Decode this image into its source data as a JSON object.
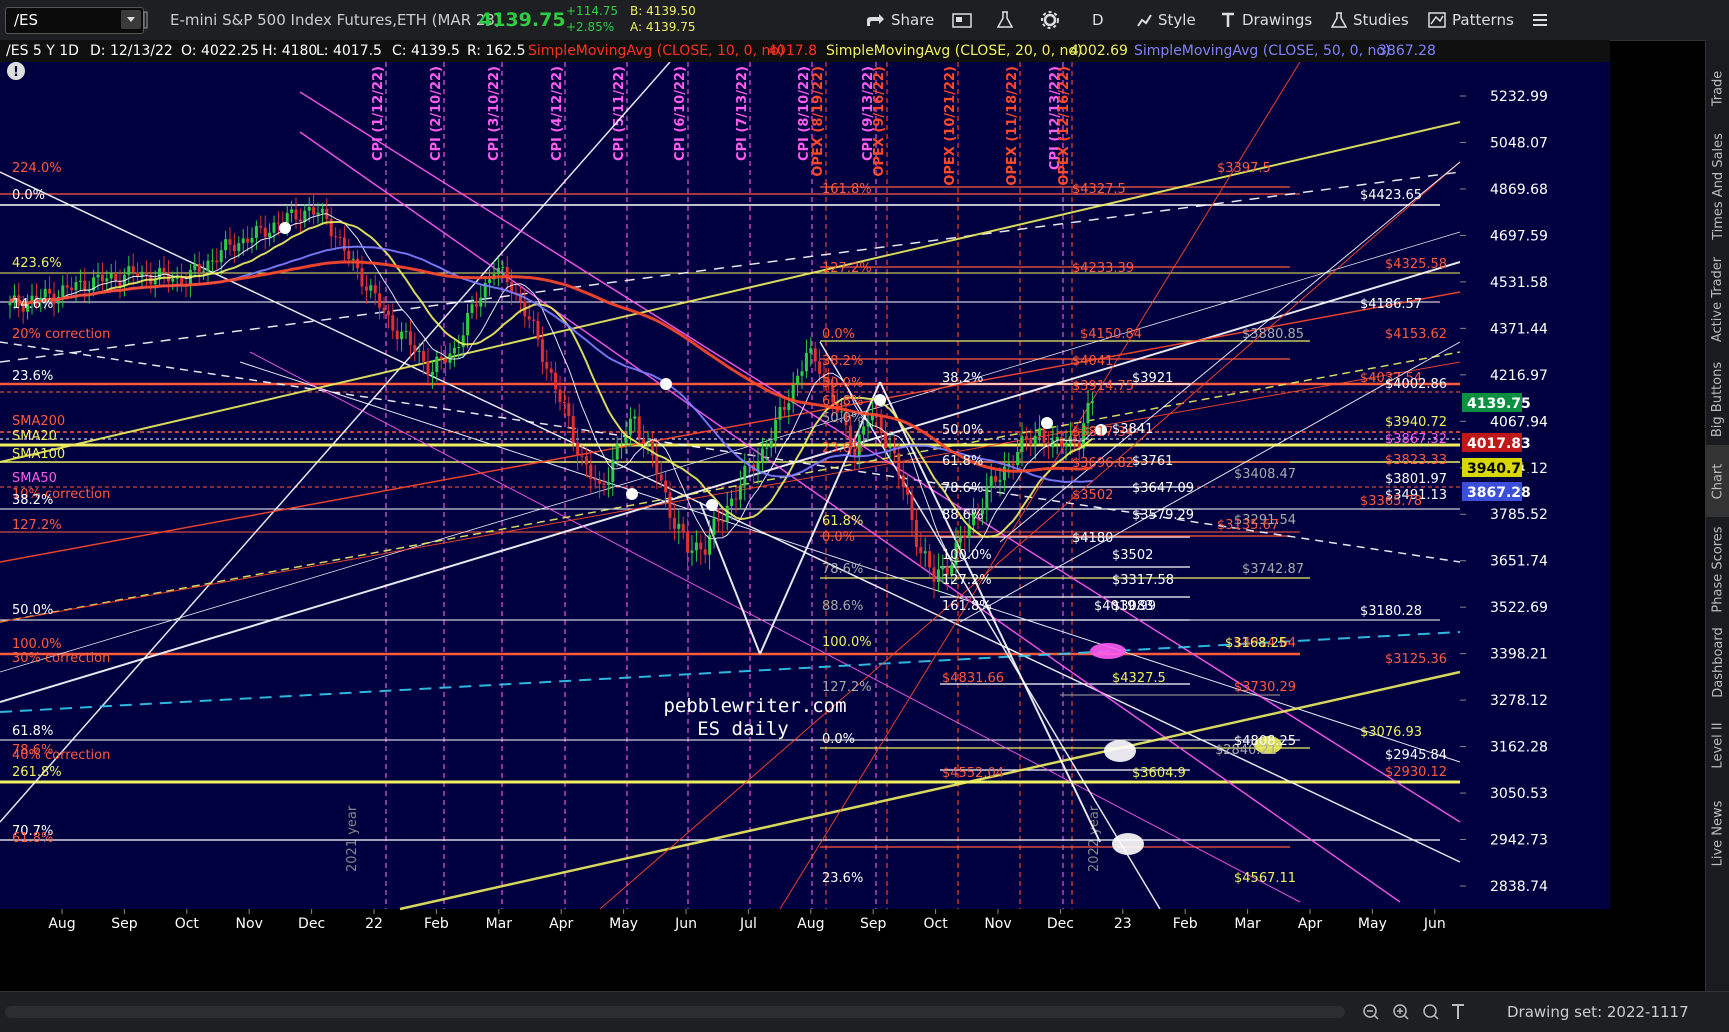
{
  "toolbar": {
    "symbol": "/ES",
    "instrument": "E-mini S&P 500 Index Futures,ETH (MAR 23)",
    "last": "4139.75",
    "change": "+114.75",
    "change_pct": "+2.85%",
    "bid": "B: 4139.50",
    "ask": "A: 4139.75",
    "share": "Share",
    "timeframe": "D",
    "style": "Style",
    "drawings": "Drawings",
    "studies": "Studies",
    "patterns": "Patterns"
  },
  "infoline": {
    "symbol_tf": "/ES 5 Y 1D",
    "date": "D: 12/13/22",
    "open": "O: 4022.25",
    "high": "H: 4180",
    "low": "L: 4017.5",
    "close": "C: 4139.5",
    "range": "R: 162.5",
    "sma10_label": "SimpleMovingAvg (CLOSE, 10, 0, no)",
    "sma10_value": "4017.8",
    "sma20_label": "SimpleMovingAvg (CLOSE, 20, 0, no)",
    "sma20_value": "4002.69",
    "sma50_label": "SimpleMovingAvg (CLOSE, 50, 0, no)",
    "sma50_value": "3867.28"
  },
  "colors": {
    "background": "#000040",
    "up": "#2ecc40",
    "down": "#e03030",
    "sma10": "#ff4020",
    "sma20": "#f0f060",
    "sma50": "#8080ff",
    "fib_red": "#ff5a3c",
    "fib_yellow": "#f0f060",
    "magenta": "#ff5cf0"
  },
  "chart_data": {
    "type": "candlestick",
    "y_ticks": [
      5232.99,
      5048.07,
      4869.68,
      4697.59,
      4531.58,
      4371.44,
      4216.97,
      4067.94,
      3924.12,
      3785.52,
      3651.74,
      3522.69,
      3398.21,
      3278.12,
      3162.28,
      3050.53,
      2942.73,
      2838.74
    ],
    "x_ticks": [
      "Aug",
      "Sep",
      "Oct",
      "Nov",
      "Dec",
      "22",
      "Feb",
      "Mar",
      "Apr",
      "May",
      "Jun",
      "Jul",
      "Aug",
      "Sep",
      "Oct",
      "Nov",
      "Dec",
      "23",
      "Feb",
      "Mar",
      "Apr",
      "May",
      "Jun"
    ],
    "price_badges": [
      {
        "value": "4139.75",
        "color": "#0a9040"
      },
      {
        "value": "4017.83",
        "color": "#c01818"
      },
      {
        "value": "3940.73",
        "color": "#d8d800"
      },
      {
        "value": "3867.28",
        "color": "#3b4fd8"
      }
    ],
    "series": [
      {
        "name": "SimpleMovingAvg (CLOSE, 10, 0, no)",
        "last": 4017.8
      },
      {
        "name": "SimpleMovingAvg (CLOSE, 20, 0, no)",
        "last": 4002.69
      },
      {
        "name": "SimpleMovingAvg (CLOSE, 50, 0, no)",
        "last": 3867.28
      }
    ],
    "close_path": [
      [
        0,
        4450
      ],
      [
        8,
        4480
      ],
      [
        18,
        4530
      ],
      [
        28,
        4560
      ],
      [
        40,
        4540
      ],
      [
        50,
        4660
      ],
      [
        56,
        4700
      ],
      [
        63,
        4760
      ],
      [
        68,
        4790
      ],
      [
        72,
        4760
      ],
      [
        76,
        4640
      ],
      [
        82,
        4500
      ],
      [
        86,
        4400
      ],
      [
        92,
        4300
      ],
      [
        96,
        4230
      ],
      [
        101,
        4300
      ],
      [
        106,
        4460
      ],
      [
        110,
        4580
      ],
      [
        114,
        4520
      ],
      [
        118,
        4400
      ],
      [
        122,
        4250
      ],
      [
        126,
        4100
      ],
      [
        130,
        3950
      ],
      [
        134,
        3850
      ],
      [
        137,
        3950
      ],
      [
        142,
        4080
      ],
      [
        146,
        3950
      ],
      [
        150,
        3800
      ],
      [
        154,
        3680
      ],
      [
        158,
        3700
      ],
      [
        162,
        3780
      ],
      [
        166,
        3880
      ],
      [
        170,
        3950
      ],
      [
        174,
        4050
      ],
      [
        178,
        4180
      ],
      [
        181,
        4280
      ],
      [
        184,
        4250
      ],
      [
        188,
        4100
      ],
      [
        192,
        3980
      ],
      [
        195,
        4080
      ],
      [
        198,
        4050
      ],
      [
        201,
        3950
      ],
      [
        204,
        3820
      ],
      [
        207,
        3680
      ],
      [
        210,
        3600
      ],
      [
        213,
        3640
      ],
      [
        216,
        3700
      ],
      [
        219,
        3780
      ],
      [
        222,
        3850
      ],
      [
        225,
        3900
      ],
      [
        228,
        3960
      ],
      [
        231,
        4000
      ],
      [
        234,
        4040
      ],
      [
        237,
        3980
      ],
      [
        240,
        4020
      ],
      [
        243,
        4000
      ],
      [
        246,
        4139
      ]
    ],
    "period_labels": [
      {
        "text": "CPI (1/12/22)",
        "color": "#ff5cf0"
      },
      {
        "text": "CPI (2/10/22)",
        "color": "#ff5cf0"
      },
      {
        "text": "CPI (3/10/22)",
        "color": "#ff5cf0"
      },
      {
        "text": "CPI (4/12/22)",
        "color": "#ff5cf0"
      },
      {
        "text": "CPI (5/11/22)",
        "color": "#ff5cf0"
      },
      {
        "text": "CPI (6/10/22)",
        "color": "#ff5cf0"
      },
      {
        "text": "CPI (7/13/22)",
        "color": "#ff5cf0"
      },
      {
        "text": "CPI (8/10/22)",
        "color": "#ff5cf0"
      },
      {
        "text": "OPEX (8/19/22)",
        "color": "#ff4a2a"
      },
      {
        "text": "CPI (9/13/22)",
        "color": "#ff5cf0"
      },
      {
        "text": "OPEX (9/16/22)",
        "color": "#ff4a2a"
      },
      {
        "text": "OPEX (10/21/22)",
        "color": "#ff4a2a"
      },
      {
        "text": "OPEX (11/18/22)",
        "color": "#ff4a2a"
      },
      {
        "text": "CPI (12/13/22)",
        "color": "#ff5cf0"
      },
      {
        "text": "OPEX (12/16/22)",
        "color": "#ff4a2a"
      }
    ],
    "year_labels": [
      "2021 year",
      "2022 year"
    ],
    "level_labels": [
      {
        "text": "224.0%",
        "color": "#ff5a3c"
      },
      {
        "text": "0.0%",
        "color": "#ffffff"
      },
      {
        "text": "423.6%",
        "color": "#f0f060"
      },
      {
        "text": "14.6%",
        "color": "#ffffff"
      },
      {
        "text": "20% correction",
        "color": "#ff5a3c"
      },
      {
        "text": "23.6%",
        "color": "#ffffff"
      },
      {
        "text": "SMA200",
        "color": "#ff5a3c"
      },
      {
        "text": "SMA20",
        "color": "#f0f060"
      },
      {
        "text": "SMA100",
        "color": "#f0f060"
      },
      {
        "text": "SMA50",
        "color": "#ff5cf0"
      },
      {
        "text": "10% correction",
        "color": "#ff5a3c"
      },
      {
        "text": "38.2%",
        "color": "#ffffff"
      },
      {
        "text": "127.2%",
        "color": "#ff5a3c"
      },
      {
        "text": "50.0%",
        "color": "#ffffff"
      },
      {
        "text": "100.0%",
        "color": "#ff5a3c"
      },
      {
        "text": "30% correction",
        "color": "#ff5a3c"
      },
      {
        "text": "61.8%",
        "color": "#ffffff"
      },
      {
        "text": "78.6%",
        "color": "#ff5a3c"
      },
      {
        "text": "40% correction",
        "color": "#ff5a3c"
      },
      {
        "text": "261.8%",
        "color": "#f0f060"
      },
      {
        "text": "70.7%",
        "color": "#ffffff"
      },
      {
        "text": "61.8%",
        "color": "#ff5a3c"
      },
      {
        "text": "161.8%",
        "color": "#ff5a3c"
      },
      {
        "text": "127.2%",
        "color": "#ff5a3c"
      },
      {
        "text": "0.0%",
        "color": "#ff5a3c"
      },
      {
        "text": "38.2%",
        "color": "#ff5a3c"
      },
      {
        "text": "50.0%",
        "color": "#ff5a3c"
      },
      {
        "text": "61.8%",
        "color": "#ff5a3c"
      },
      {
        "text": "50.0%",
        "color": "#aaaaaa"
      },
      {
        "text": "23.6%",
        "color": "#ff5a3c"
      },
      {
        "text": "61.8%",
        "color": "#f0f060"
      },
      {
        "text": "0.0%",
        "color": "#ff5a3c"
      },
      {
        "text": "78.6%",
        "color": "#aaaaaa"
      },
      {
        "text": "88.6%",
        "color": "#aaaaaa"
      },
      {
        "text": "100.0%",
        "color": "#f0f060"
      },
      {
        "text": "127.2%",
        "color": "#aaaaaa"
      },
      {
        "text": "0.0%",
        "color": "#ffffff"
      },
      {
        "text": "23.6%",
        "color": "#ffffff"
      },
      {
        "text": "38.2%",
        "color": "#ffffff"
      },
      {
        "text": "50.0%",
        "color": "#ffffff"
      },
      {
        "text": "61.8%",
        "color": "#ffffff"
      },
      {
        "text": "78.6%",
        "color": "#ffffff"
      },
      {
        "text": "88.6%",
        "color": "#ffffff"
      },
      {
        "text": "100.0%",
        "color": "#ffffff"
      },
      {
        "text": "127.2%",
        "color": "#ffffff"
      },
      {
        "text": "161.8%",
        "color": "#ffffff"
      },
      {
        "text": "$4831.66",
        "color": "#ff5a3c"
      },
      {
        "text": "$4552.04",
        "color": "#ff5a3c"
      },
      {
        "text": "$4327.5",
        "color": "#ff5a3c"
      },
      {
        "text": "$4233.39",
        "color": "#ff5a3c"
      },
      {
        "text": "$4150.84",
        "color": "#ff5a3c"
      },
      {
        "text": "$4041",
        "color": "#ff5a3c"
      },
      {
        "text": "$3914.75",
        "color": "#ff5a3c"
      },
      {
        "text": "$3817.34",
        "color": "#ff5a3c"
      },
      {
        "text": "$3696.82",
        "color": "#ff5a3c"
      },
      {
        "text": "$3502",
        "color": "#ff5a3c"
      },
      {
        "text": "$4180",
        "color": "#ffffff"
      },
      {
        "text": "$4019.99",
        "color": "#ffffff"
      },
      {
        "text": "$3921",
        "color": "#ffffff"
      },
      {
        "text": "$3841",
        "color": "#ffffff"
      },
      {
        "text": "$3761",
        "color": "#ffffff"
      },
      {
        "text": "$3647.09",
        "color": "#ffffff"
      },
      {
        "text": "$3579.29",
        "color": "#ffffff"
      },
      {
        "text": "$3502",
        "color": "#ffffff"
      },
      {
        "text": "$3317.58",
        "color": "#ffffff"
      },
      {
        "text": "$3083",
        "color": "#ffffff"
      },
      {
        "text": "$4327.5",
        "color": "#f0f060"
      },
      {
        "text": "$3604.9",
        "color": "#f0f060"
      },
      {
        "text": "$3880.85",
        "color": "#aaaaaa"
      },
      {
        "text": "$3742.87",
        "color": "#aaaaaa"
      },
      {
        "text": "$3408.47",
        "color": "#aaaaaa"
      },
      {
        "text": "$3291.54",
        "color": "#aaaaaa"
      },
      {
        "text": "$4914.64",
        "color": "#ff5a3c"
      },
      {
        "text": "$3730.29",
        "color": "#ff5a3c"
      },
      {
        "text": "$3397.5",
        "color": "#ff5a3c"
      },
      {
        "text": "$3135.67",
        "color": "#ff5a3c"
      },
      {
        "text": "$3168.25",
        "color": "#f0f060"
      },
      {
        "text": "$2840.21",
        "color": "#aaaaaa"
      },
      {
        "text": "$4808.25",
        "color": "#ffffff"
      },
      {
        "text": "$4567.11",
        "color": "#f0f060"
      },
      {
        "text": "$4423.65",
        "color": "#ffffff"
      },
      {
        "text": "$4325.58",
        "color": "#ff5a3c"
      },
      {
        "text": "$4186.57",
        "color": "#ffffff"
      },
      {
        "text": "$4153.62",
        "color": "#ff5a3c"
      },
      {
        "text": "$4037.54",
        "color": "#ff5a3c"
      },
      {
        "text": "$4002.86",
        "color": "#ffffff"
      },
      {
        "text": "$3940.72",
        "color": "#f0f060"
      },
      {
        "text": "$3867.32",
        "color": "#ff5cf0"
      },
      {
        "text": "$3823.33",
        "color": "#ff5a3c"
      },
      {
        "text": "$3801.97",
        "color": "#ffffff"
      },
      {
        "text": "$3491.13",
        "color": "#ffffff"
      },
      {
        "text": "$3365.78",
        "color": "#ff5a3c"
      },
      {
        "text": "$3180.28",
        "color": "#ffffff"
      },
      {
        "text": "$3125.36",
        "color": "#ff5a3c"
      },
      {
        "text": "$3076.93",
        "color": "#f0f060"
      },
      {
        "text": "$2945.84",
        "color": "#ffffff"
      },
      {
        "text": "$2930.12",
        "color": "#ff5a3c"
      }
    ],
    "watermark": [
      "pebblewriter.com",
      "ES daily"
    ]
  },
  "right_tabs": [
    "Trade",
    "Times And Sales",
    "Active Trader",
    "Big Buttons",
    "Chart",
    "Phase Scores",
    "Dashboard",
    "Level II",
    "Live News"
  ],
  "bottom": {
    "drawing_set": "Drawing set: 2022-1117"
  }
}
